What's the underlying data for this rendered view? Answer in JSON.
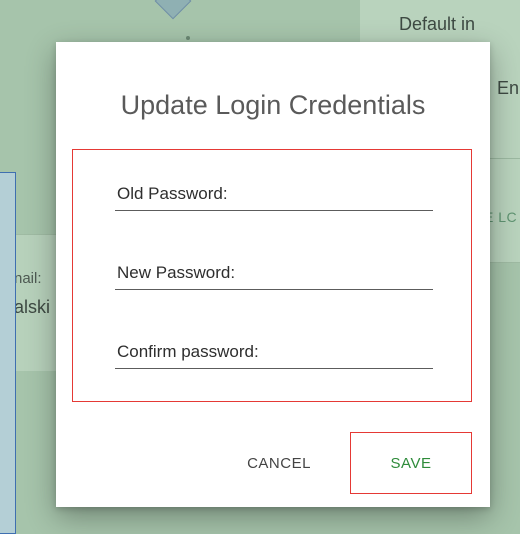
{
  "background": {
    "default_text": "Default in",
    "en_text": "En",
    "link_text": "E LC",
    "email_label": "nail:",
    "email_value": "alski"
  },
  "dialog": {
    "title": "Update Login Credentials",
    "fields": {
      "old_password_label": "Old Password:",
      "new_password_label": "New Password:",
      "confirm_password_label": "Confirm password:"
    },
    "actions": {
      "cancel_label": "CANCEL",
      "save_label": "SAVE"
    }
  },
  "colors": {
    "overlay_background": "#a6c4ab",
    "highlight_border": "#e53935",
    "save_text": "#2e8b3a",
    "title_text": "#5a5a5a"
  }
}
